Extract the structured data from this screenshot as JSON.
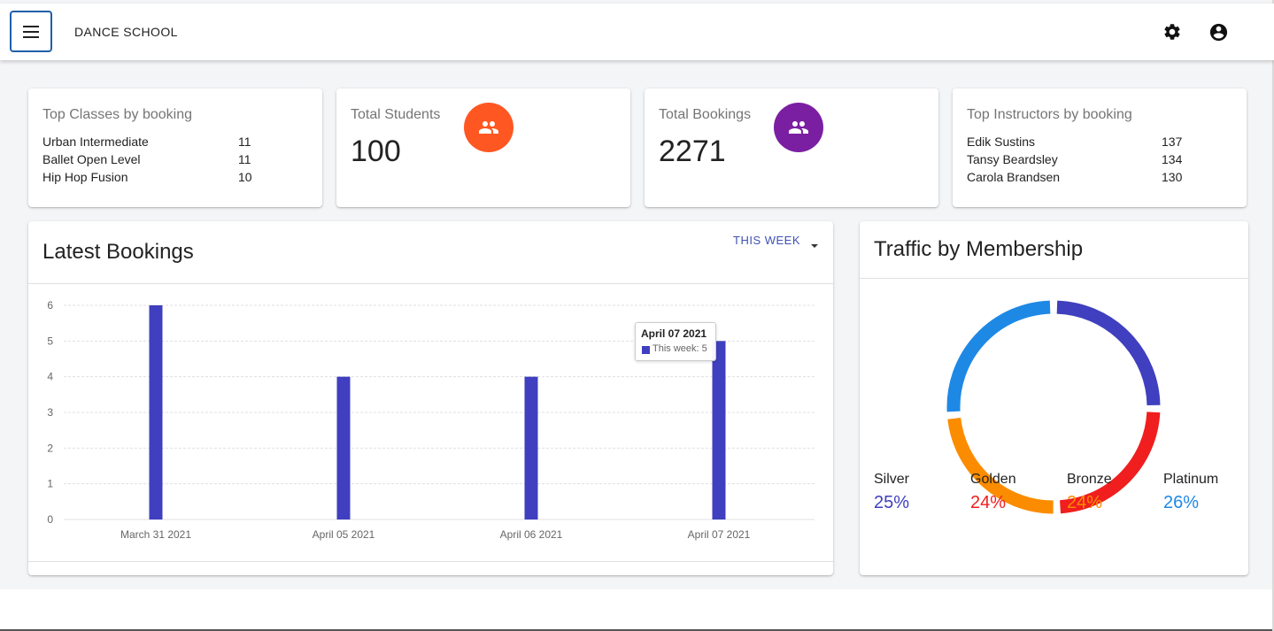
{
  "app": {
    "title": "DANCE SCHOOL",
    "icons": [
      "menu-icon",
      "settings-icon",
      "account-circle-icon"
    ]
  },
  "top_classes": {
    "label": "Top Classes by booking",
    "rows": [
      {
        "name": "Urban Intermediate",
        "count": "11"
      },
      {
        "name": "Ballet Open Level",
        "count": "11"
      },
      {
        "name": "Hip Hop Fusion",
        "count": "10"
      }
    ]
  },
  "total_students": {
    "label": "Total Students",
    "value": "100",
    "icon": "people-icon",
    "color": "#ff5722"
  },
  "total_bookings": {
    "label": "Total Bookings",
    "value": "2271",
    "icon": "people-icon",
    "color": "#7b1fa2"
  },
  "top_instructors": {
    "label": "Top Instructors by booking",
    "rows": [
      {
        "name": "Edik Sustins",
        "count": "137"
      },
      {
        "name": "Tansy Beardsley",
        "count": "134"
      },
      {
        "name": "Carola Brandsen",
        "count": "130"
      }
    ]
  },
  "latest_bookings": {
    "title": "Latest Bookings",
    "period_button": "THIS WEEK",
    "tooltip": {
      "title": "April 07 2021",
      "text": "This week: 5"
    }
  },
  "traffic": {
    "title": "Traffic by Membership",
    "items": [
      {
        "name": "Silver",
        "percent": "25%",
        "color": "#3f3fbf"
      },
      {
        "name": "Golden",
        "percent": "24%",
        "color": "#f01e1e"
      },
      {
        "name": "Bronze",
        "percent": "24%",
        "color": "#fb8c00"
      },
      {
        "name": "Platinum",
        "percent": "26%",
        "color": "#1e88e5"
      }
    ]
  },
  "chart_data": {
    "type": "bar",
    "categories": [
      "March 31 2021",
      "April 05 2021",
      "April 06 2021",
      "April 07 2021"
    ],
    "series": [
      {
        "name": "This week",
        "values": [
          6,
          4,
          4,
          5
        ],
        "color": "#3f3fbf"
      }
    ],
    "yticks": [
      "0",
      "1",
      "2",
      "3",
      "4",
      "5",
      "6"
    ],
    "ylim": [
      0,
      6
    ],
    "grid": true
  }
}
